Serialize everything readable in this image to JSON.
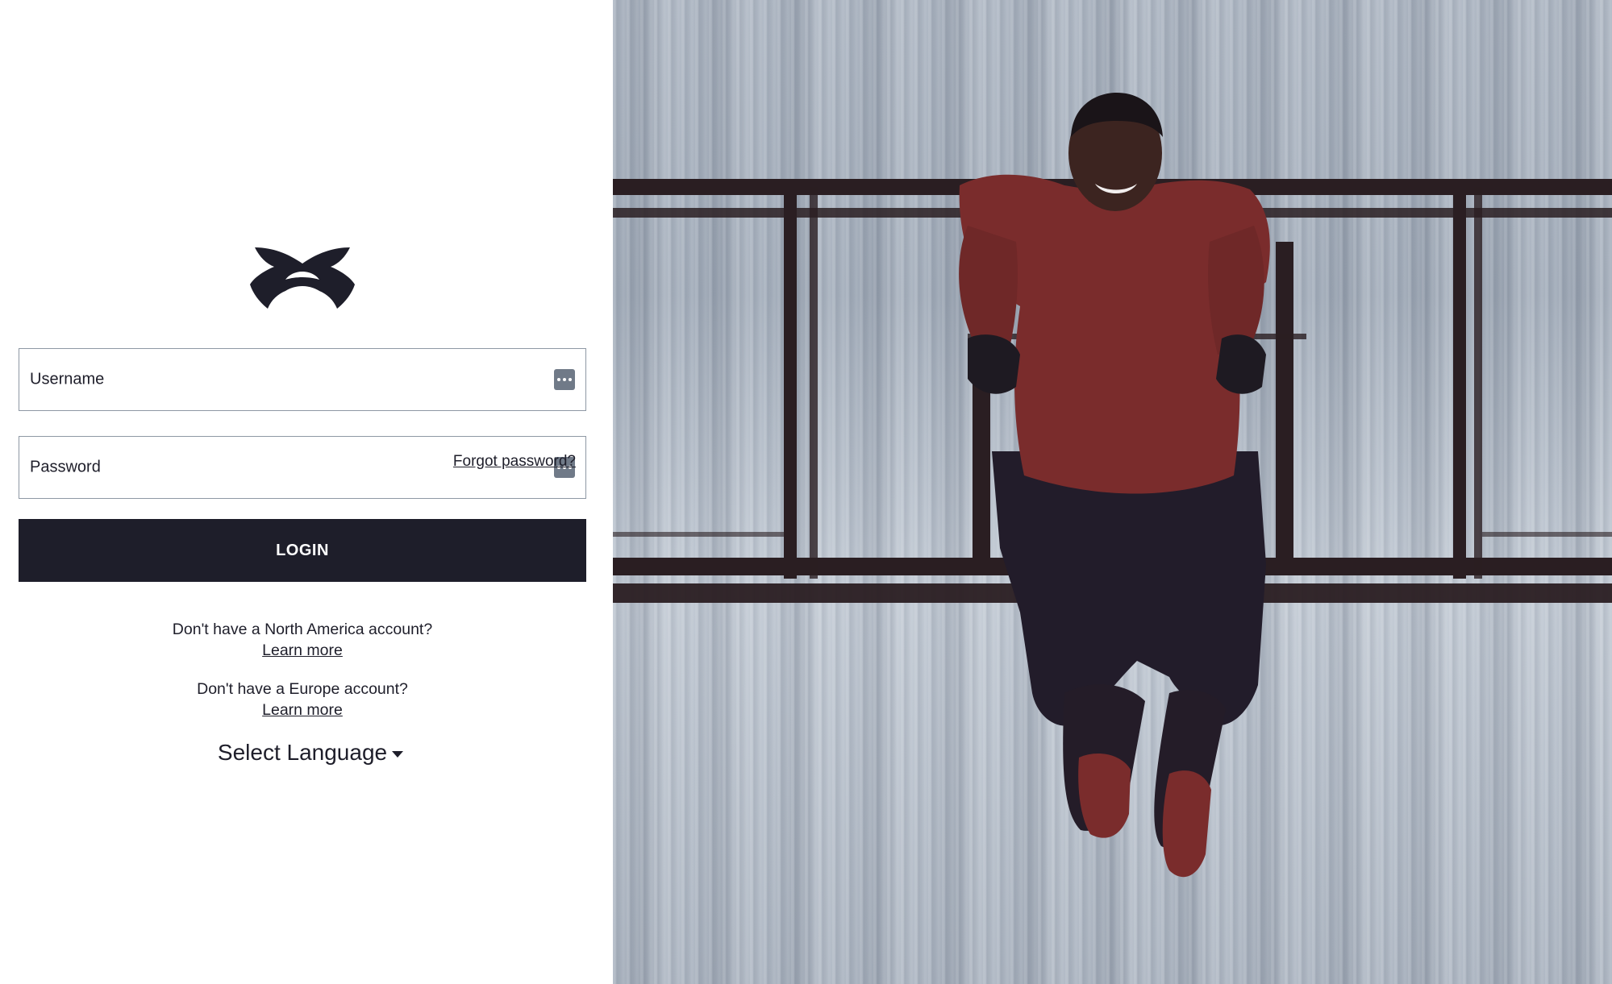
{
  "brand": {
    "logo_icon": "under-armour-logo-icon"
  },
  "login_form": {
    "username_label": "Username",
    "username_value": "",
    "password_label": "Password",
    "password_value": "",
    "forgot_password": "Forgot password?",
    "password_manager_icon": "password-manager-icon",
    "login_button": "LOGIN"
  },
  "accounts": {
    "north_america_prompt": "Don't have a North America account?",
    "north_america_link": "Learn more",
    "europe_prompt": "Don't have a Europe account?",
    "europe_link": "Learn more"
  },
  "language": {
    "label": "Select Language",
    "caret_icon": "caret-down-icon"
  },
  "colors": {
    "primary_dark": "#1e1e2a",
    "field_border": "#8e98a4",
    "shirt_red": "#7a2c2c"
  }
}
